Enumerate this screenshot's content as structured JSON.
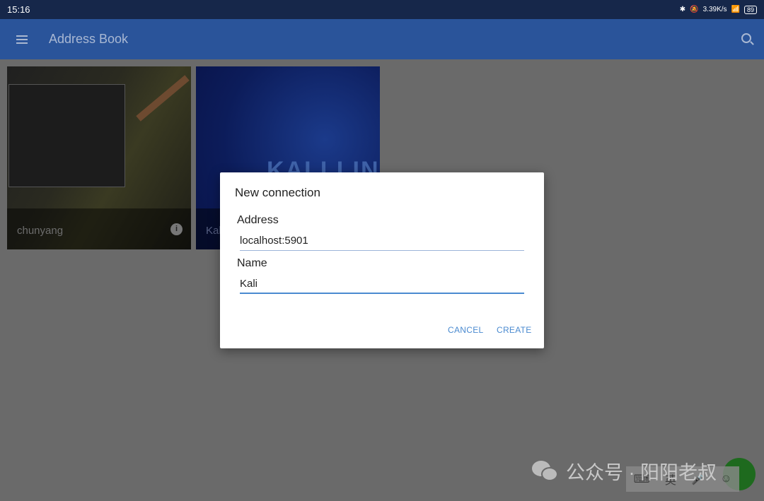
{
  "status_bar": {
    "time": "15:16",
    "net_speed": "3.39K/s",
    "battery": "89",
    "icons": [
      "bluetooth-icon",
      "mute-icon",
      "wifi-icon",
      "battery-icon"
    ]
  },
  "app_bar": {
    "title": "Address Book",
    "icons": [
      "menu-icon",
      "search-icon"
    ]
  },
  "connections": [
    {
      "name": "chunyang"
    },
    {
      "name": "Kali",
      "wallpaper_text": "KALI LIN"
    }
  ],
  "dialog": {
    "title": "New connection",
    "address_label": "Address",
    "address_value": "localhost:5901",
    "name_label": "Name",
    "name_value": "Kali",
    "cancel": "CANCEL",
    "create": "CREATE"
  },
  "watermark": {
    "text": "公众号 · 阳阳老叔"
  },
  "ime_bar": {
    "lang": "英"
  },
  "colors": {
    "accent": "#4a8ad0",
    "app_bar": "#2a549a",
    "fab": "#1e6a1e"
  }
}
